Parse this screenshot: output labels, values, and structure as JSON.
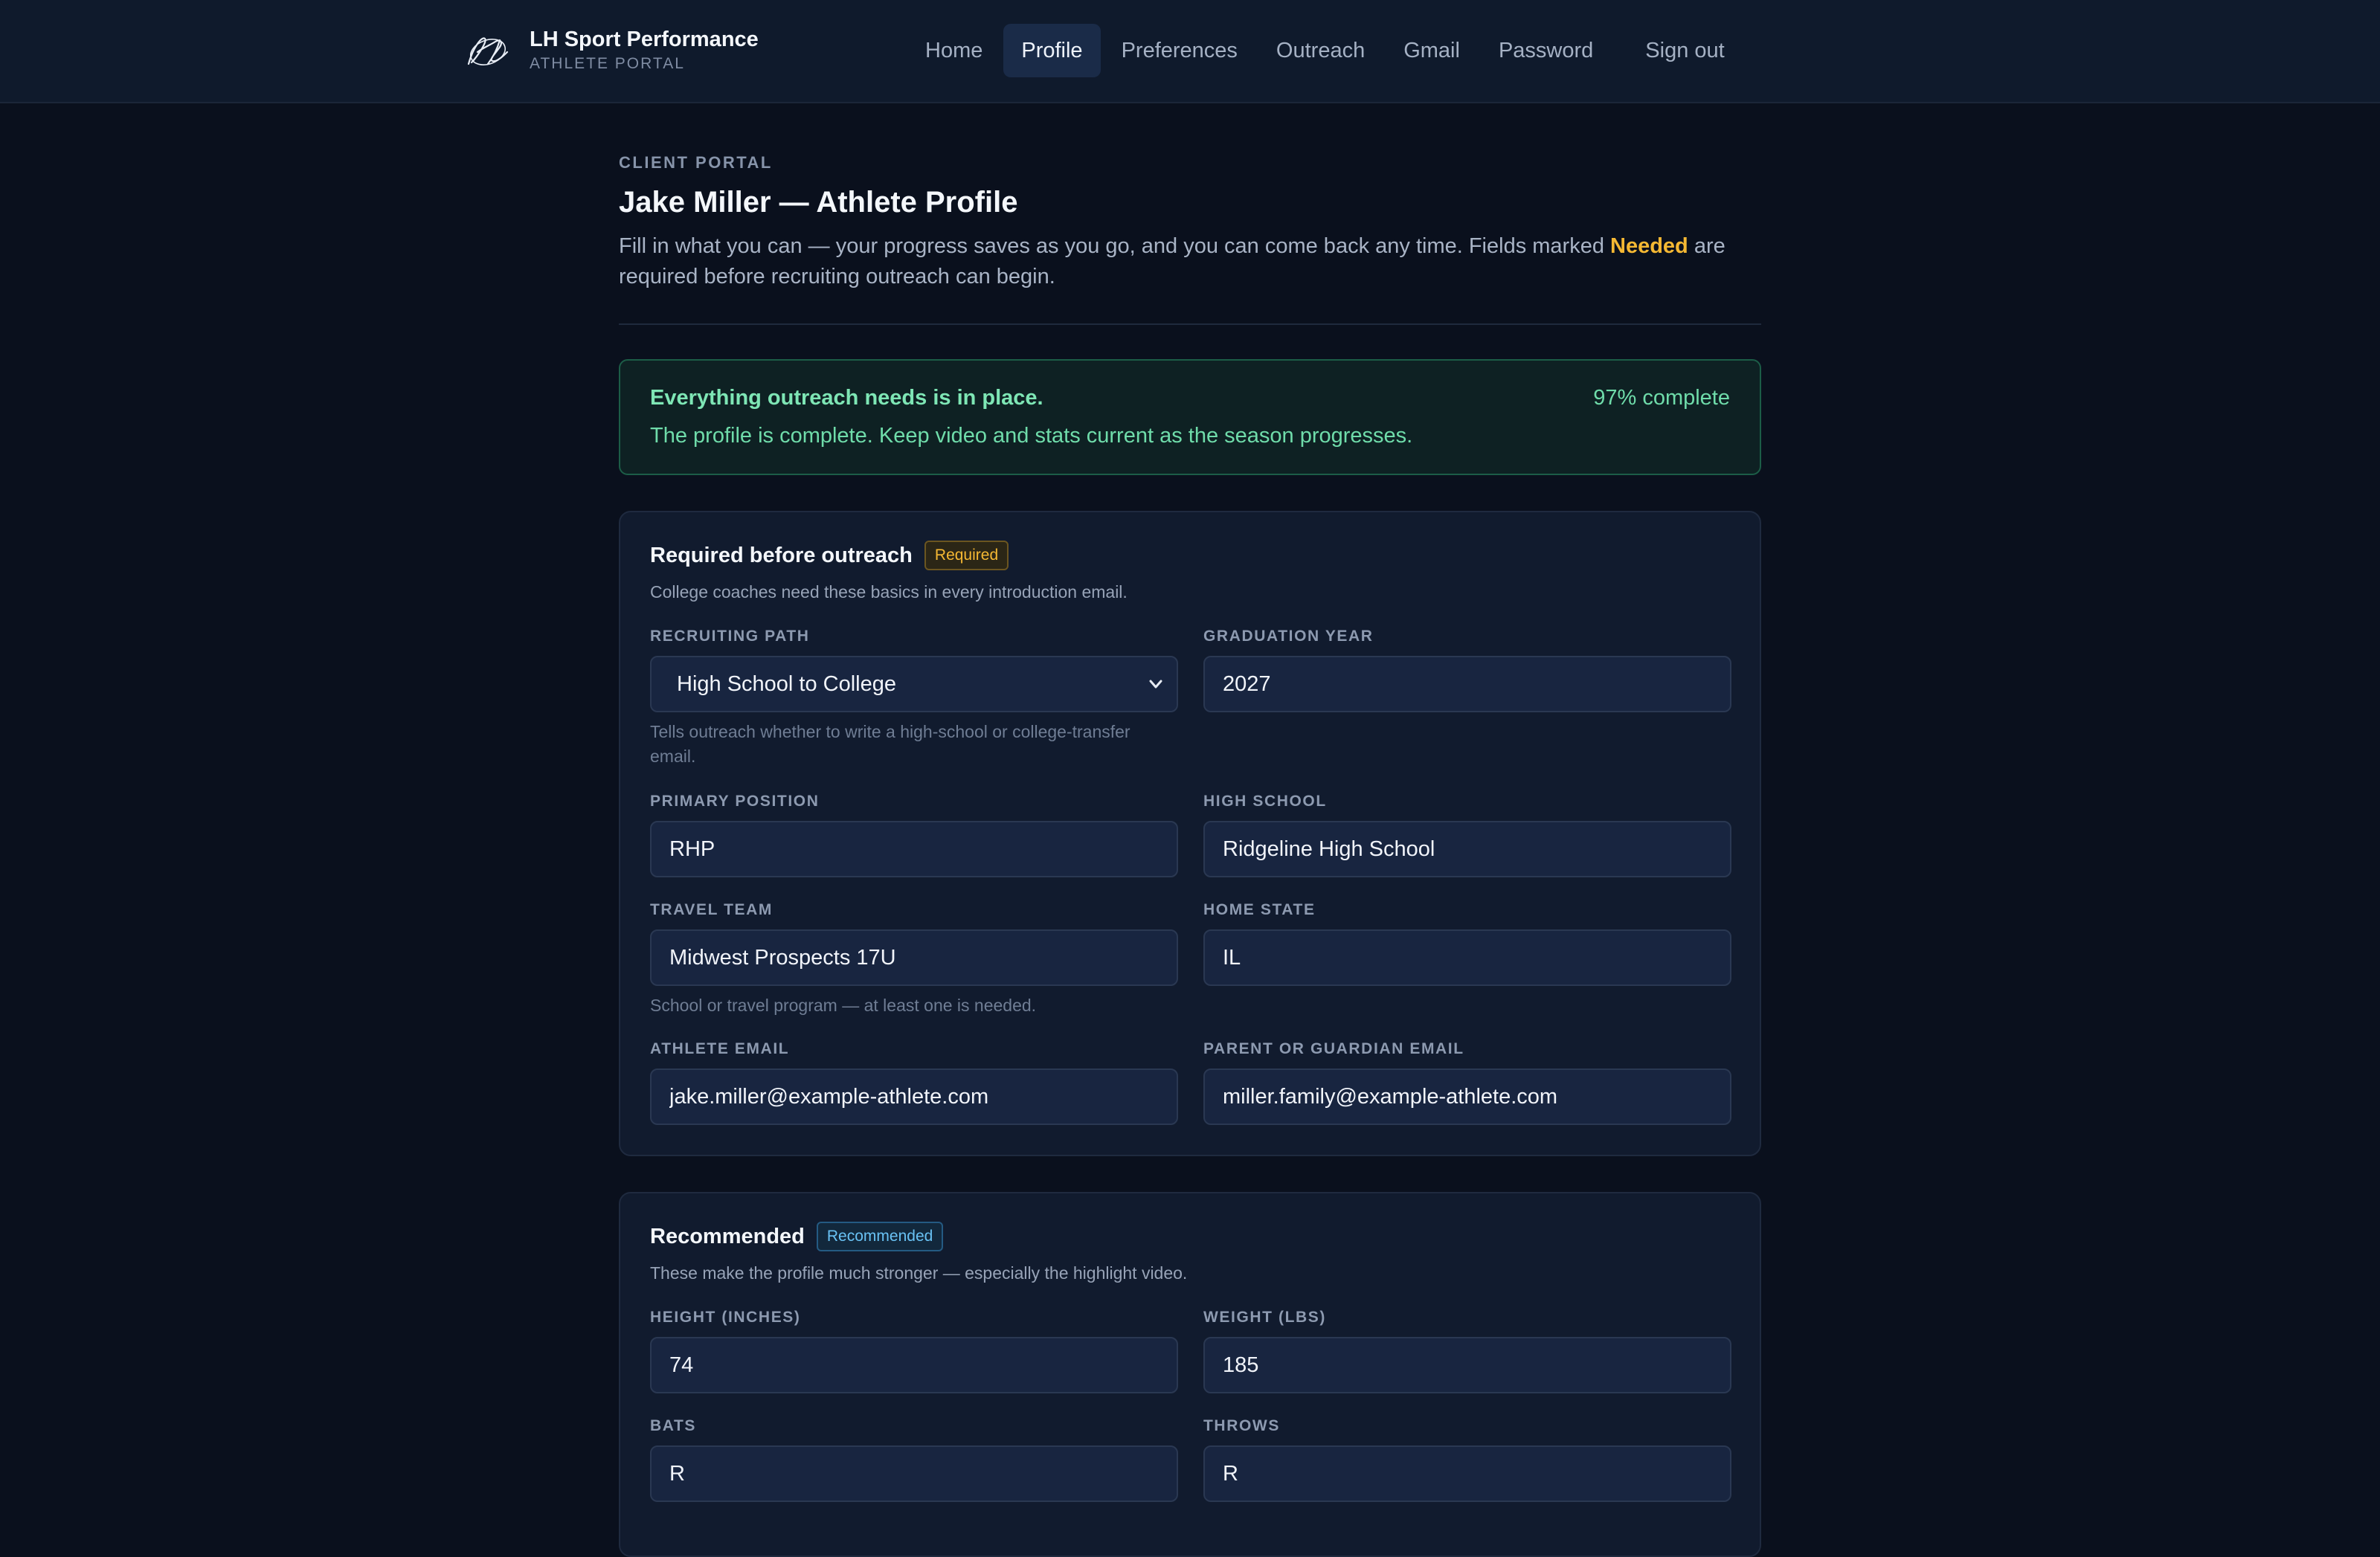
{
  "header": {
    "brand_title": "LH Sport Performance",
    "brand_subtitle": "ATHLETE PORTAL",
    "nav": [
      {
        "label": "Home",
        "active": false
      },
      {
        "label": "Profile",
        "active": true
      },
      {
        "label": "Preferences",
        "active": false
      },
      {
        "label": "Outreach",
        "active": false
      },
      {
        "label": "Gmail",
        "active": false
      },
      {
        "label": "Password",
        "active": false
      }
    ],
    "signout_label": "Sign out"
  },
  "page": {
    "eyebrow": "CLIENT PORTAL",
    "title": "Jake Miller — Athlete Profile",
    "intro_before": "Fill in what you can — your progress saves as you go, and you can come back any time. Fields marked ",
    "intro_needed": "Needed",
    "intro_after": " are required before recruiting outreach can begin."
  },
  "status": {
    "title": "Everything outreach needs is in place.",
    "text": "The profile is complete. Keep video and stats current as the season progresses.",
    "percent_label": "97% complete",
    "percent": 97
  },
  "required": {
    "title": "Required before outreach",
    "badge": "Required",
    "desc": "College coaches need these basics in every introduction email.",
    "recruiting_path": {
      "label": "RECRUITING PATH",
      "value": "High School to College",
      "hint": "Tells outreach whether to write a high-school or college-transfer email."
    },
    "graduation_year": {
      "label": "GRADUATION YEAR",
      "value": "2027"
    },
    "primary_position": {
      "label": "PRIMARY POSITION",
      "value": "RHP"
    },
    "high_school": {
      "label": "HIGH SCHOOL",
      "value": "Ridgeline High School"
    },
    "travel_team": {
      "label": "TRAVEL TEAM",
      "value": "Midwest Prospects 17U"
    },
    "home_state": {
      "label": "HOME STATE",
      "value": "IL"
    },
    "team_hint": "School or travel program — at least one is needed.",
    "athlete_email": {
      "label": "ATHLETE EMAIL",
      "value": "jake.miller@example-athlete.com"
    },
    "parent_email": {
      "label": "PARENT OR GUARDIAN EMAIL",
      "value": "miller.family@example-athlete.com"
    }
  },
  "recommended": {
    "title": "Recommended",
    "badge": "Recommended",
    "desc": "These make the profile much stronger — especially the highlight video.",
    "height": {
      "label": "HEIGHT (INCHES)",
      "value": "74"
    },
    "weight": {
      "label": "WEIGHT (LBS)",
      "value": "185"
    },
    "bats": {
      "label": "BATS",
      "value": "R"
    },
    "throws": {
      "label": "THROWS",
      "value": "R"
    }
  }
}
